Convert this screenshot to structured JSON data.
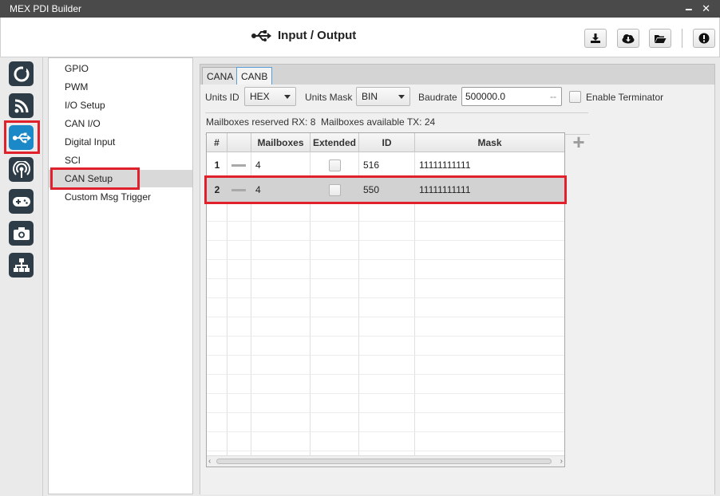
{
  "window": {
    "title": "MEX PDI Builder",
    "controls": "🗕 ✕"
  },
  "header": {
    "title": "Input / Output",
    "icon": "usb-icon",
    "buttons": [
      "download-icon",
      "cloud-download-icon",
      "folder-open-icon",
      "info-icon"
    ]
  },
  "leftbar": {
    "icons": [
      "power-ring-icon",
      "rss-icon",
      "usb-icon",
      "broadcast-icon",
      "gamepad-icon",
      "camera-icon",
      "network-icon"
    ],
    "active": "usb-icon"
  },
  "nav": {
    "items": [
      {
        "label": "GPIO"
      },
      {
        "label": "PWM"
      },
      {
        "label": "I/O Setup"
      },
      {
        "label": "CAN I/O"
      },
      {
        "label": "Digital Input"
      },
      {
        "label": "SCI"
      },
      {
        "label": "CAN Setup"
      },
      {
        "label": "Custom Msg Trigger"
      }
    ],
    "selected": "CAN Setup"
  },
  "tabs": [
    {
      "label": "CANA"
    },
    {
      "label": "CANB"
    }
  ],
  "form": {
    "units_id_label": "Units ID",
    "units_id_value": "HEX",
    "units_mask_label": "Units Mask",
    "units_mask_value": "BIN",
    "baudrate_label": "Baudrate",
    "baudrate_value": "500000.0",
    "baudrate_suffix": "--",
    "enable_terminator_label": "Enable Terminator"
  },
  "mailbox_info": {
    "reserved_rx": "Mailboxes reserved RX:  8",
    "available_tx": "Mailboxes available TX:  24"
  },
  "table": {
    "headers": [
      "#",
      "",
      "Mailboxes",
      "Extended",
      "ID",
      "Mask"
    ],
    "rows": [
      {
        "num": "1",
        "mailboxes": "4",
        "id": "516",
        "mask": "11111111111"
      },
      {
        "num": "2",
        "mailboxes": "4",
        "id": "550",
        "mask": "11111111111"
      }
    ]
  },
  "colors": {
    "highlight": "#e0202a",
    "active_icon": "#1b88c8",
    "icon_bg": "#2d3c46"
  }
}
